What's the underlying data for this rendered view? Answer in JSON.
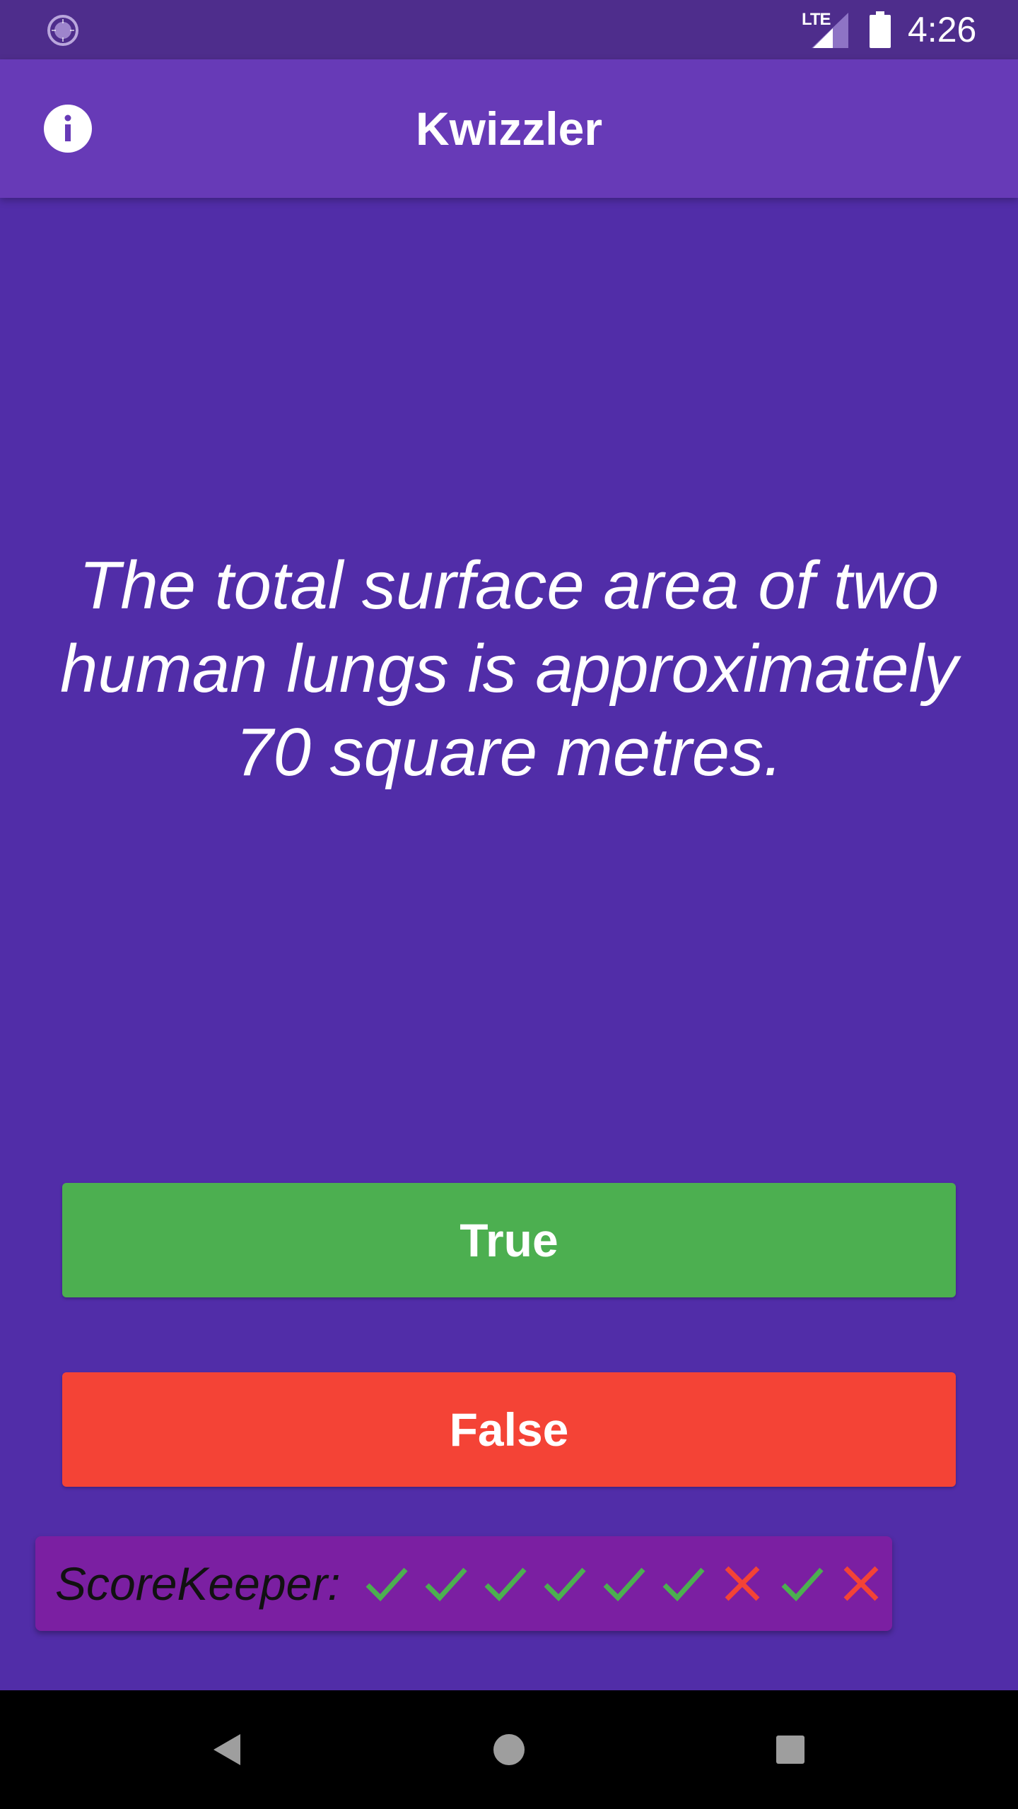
{
  "status_bar": {
    "network_label": "LTE",
    "time": "4:26"
  },
  "app_bar": {
    "title": "Kwizzler",
    "info_icon": "info-icon"
  },
  "question": {
    "text": "The total surface area of two human lungs is approximately 70 square metres."
  },
  "buttons": {
    "true_label": "True",
    "false_label": "False"
  },
  "score_keeper": {
    "label": "ScoreKeeper:",
    "results": [
      "correct",
      "correct",
      "correct",
      "correct",
      "correct",
      "correct",
      "wrong",
      "correct",
      "wrong"
    ]
  },
  "colors": {
    "background": "#512DA8",
    "app_bar": "#673AB7",
    "true_button": "#4CAF50",
    "false_button": "#F44336",
    "score_keeper_bg": "#7B1FA2",
    "correct_icon": "#4CAF50",
    "wrong_icon": "#F44336"
  },
  "nav_bar": {
    "icons": [
      "back-icon",
      "home-icon",
      "recents-icon"
    ]
  }
}
